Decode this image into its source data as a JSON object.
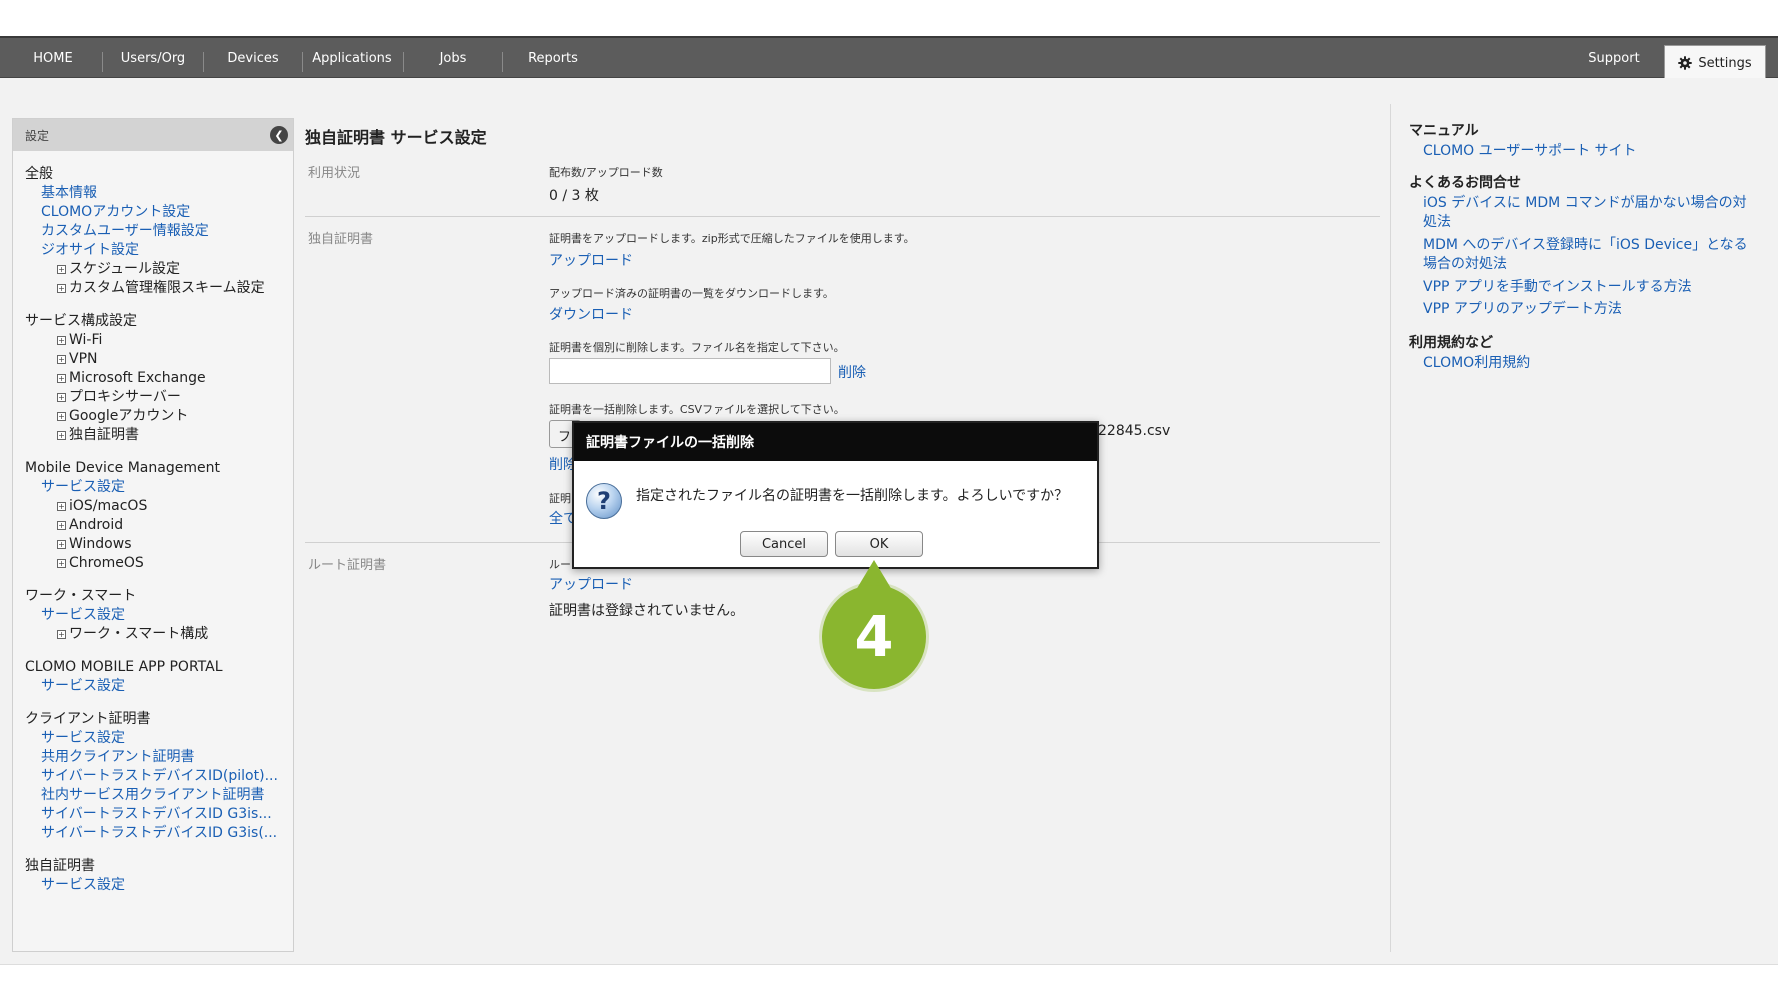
{
  "nav": {
    "items": [
      "HOME",
      "Users/Org",
      "Devices",
      "Applications",
      "Jobs",
      "Reports"
    ],
    "support": "Support",
    "settings": "Settings"
  },
  "sidebar": {
    "header": "設定",
    "groups": [
      {
        "title": "全般",
        "entries": [
          {
            "kind": "link",
            "label": "基本情報"
          },
          {
            "kind": "link",
            "label": "CLOMOアカウント設定"
          },
          {
            "kind": "link",
            "label": "カスタムユーザー情報設定"
          },
          {
            "kind": "link",
            "label": "ジオサイト設定"
          },
          {
            "kind": "tree",
            "label": "スケジュール設定"
          },
          {
            "kind": "tree",
            "label": "カスタム管理権限スキーム設定"
          }
        ]
      },
      {
        "title": "サービス構成設定",
        "entries": [
          {
            "kind": "tree",
            "label": "Wi-Fi"
          },
          {
            "kind": "tree",
            "label": "VPN"
          },
          {
            "kind": "tree",
            "label": "Microsoft Exchange"
          },
          {
            "kind": "tree",
            "label": "プロキシサーバー"
          },
          {
            "kind": "tree",
            "label": "Googleアカウント"
          },
          {
            "kind": "tree",
            "label": "独自証明書"
          }
        ]
      },
      {
        "title": "Mobile Device Management",
        "entries": [
          {
            "kind": "link",
            "label": "サービス設定"
          },
          {
            "kind": "tree",
            "label": "iOS/macOS"
          },
          {
            "kind": "tree",
            "label": "Android"
          },
          {
            "kind": "tree",
            "label": "Windows"
          },
          {
            "kind": "tree",
            "label": "ChromeOS"
          }
        ]
      },
      {
        "title": "ワーク・スマート",
        "entries": [
          {
            "kind": "link",
            "label": "サービス設定"
          },
          {
            "kind": "tree",
            "label": "ワーク・スマート構成"
          }
        ]
      },
      {
        "title": "CLOMO MOBILE APP PORTAL",
        "entries": [
          {
            "kind": "link",
            "label": "サービス設定"
          }
        ]
      },
      {
        "title": "クライアント証明書",
        "entries": [
          {
            "kind": "link",
            "label": "サービス設定"
          },
          {
            "kind": "link",
            "label": "共用クライアント証明書"
          },
          {
            "kind": "link",
            "label": "サイバートラストデバイスID(pilot)..."
          },
          {
            "kind": "link",
            "label": "社内サービス用クライアント証明書"
          },
          {
            "kind": "link",
            "label": "サイバートラストデバイスID G3is..."
          },
          {
            "kind": "link",
            "label": "サイバートラストデバイスID G3is(..."
          }
        ]
      },
      {
        "title": "独自証明書",
        "entries": [
          {
            "kind": "link",
            "label": "サービス設定"
          }
        ]
      }
    ]
  },
  "main": {
    "title": "独自証明書 サービス設定",
    "usage": {
      "label": "利用状況",
      "caption": "配布数/アップロード数",
      "value": "0 / 3 枚"
    },
    "custom_cert": {
      "label": "独自証明書",
      "upload_desc": "証明書をアップロードします。zip形式で圧縮したファイルを使用します。",
      "upload_link": "アップロード",
      "download_desc": "アップロード済みの証明書の一覧をダウンロードします。",
      "download_link": "ダウンロード",
      "delete_desc": "証明書を個別に削除します。ファイル名を指定して下さい。",
      "delete_input_value": "",
      "delete_link": "削除",
      "bulk_desc": "証明書を一括削除します。CSVファイルを選択して下さい。",
      "file_btn": "フ",
      "file_name": "22845.csv",
      "bulk_link": "削除",
      "all_desc": "証明",
      "all_link": "全て"
    },
    "root_cert": {
      "label": "ルート証明書",
      "desc": "ルー",
      "upload_link": "アップロード",
      "empty": "証明書は登録されていません。"
    }
  },
  "right_panel": {
    "manual_title": "マニュアル",
    "manual_link": "CLOMO ユーザーサポート サイト",
    "faq_title": "よくあるお問合せ",
    "faq_links": [
      "iOS デバイスに MDM コマンドが届かない場合の対処法",
      "MDM へのデバイス登録時に「iOS Device」となる場合の対処法",
      "VPP アプリを手動でインストールする方法",
      "VPP アプリのアップデート方法"
    ],
    "terms_title": "利用規約など",
    "terms_link": "CLOMO利用規約"
  },
  "dialog": {
    "title": "証明書ファイルの一括削除",
    "message": "指定されたファイル名の証明書を一括削除します。よろしいですか？",
    "icon_glyph": "?",
    "cancel": "Cancel",
    "ok": "OK"
  },
  "step_marker": "4",
  "colors": {
    "nav_bg": "#5c5c5c",
    "link": "#1a5fb4",
    "dialog_title_bg": "#0c0c0c",
    "step_marker": "#8ab62f"
  }
}
